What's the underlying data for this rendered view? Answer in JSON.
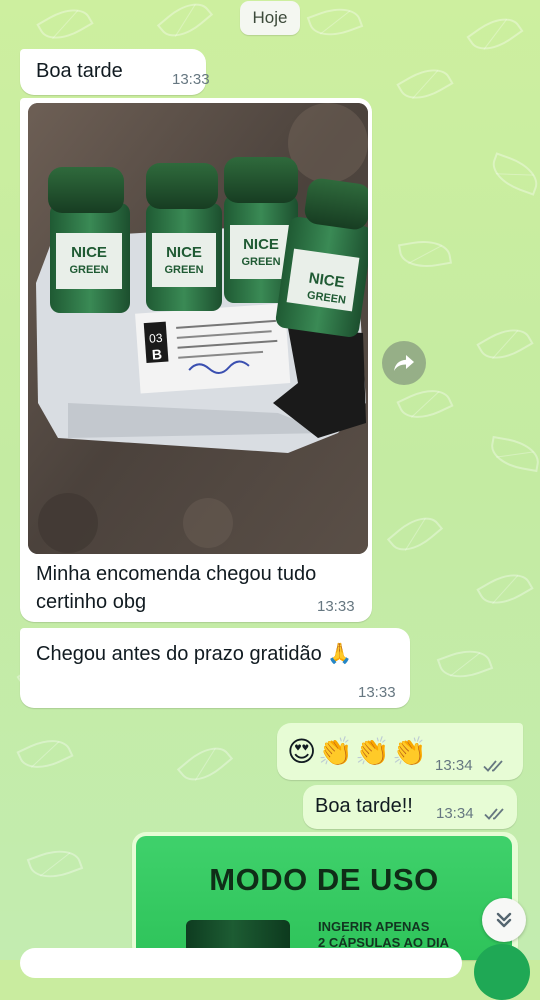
{
  "date_chip": "Hoje",
  "messages": [
    {
      "text": "Boa tarde",
      "time": "13:33"
    },
    {
      "caption": "Minha encomenda chegou tudo certinho obg",
      "time": "13:33",
      "photo": {
        "brand_line1": "NICE",
        "brand_line2": "GREEN",
        "label_code": "03",
        "label_letter": "B"
      }
    },
    {
      "text": "Chegou antes do prazo gratidão 🙏",
      "time": "13:33"
    },
    {
      "emojis": [
        "😍",
        "👏",
        "👏",
        "👏"
      ],
      "time": "13:34",
      "status": "read"
    },
    {
      "text": "Boa tarde!!",
      "time": "13:34",
      "status": "read"
    },
    {
      "card": {
        "title": "MODO DE USO",
        "subtitle_line1": "INGERIR APENAS",
        "subtitle_line2": "2 CÁPSULAS AO DIA"
      }
    }
  ],
  "icons": {
    "forward": "forward-icon",
    "scroll_down": "double-chevron-down-icon",
    "read_ticks": "double-check-icon"
  },
  "colors": {
    "chat_background": "#c9ec9f",
    "incoming_bubble": "#ffffff",
    "outgoing_bubble": "#e7fcd5",
    "timestamp": "#667781",
    "read_tick": "#667781",
    "card_green": "#3fd16b",
    "mic_green": "#1fa855"
  }
}
